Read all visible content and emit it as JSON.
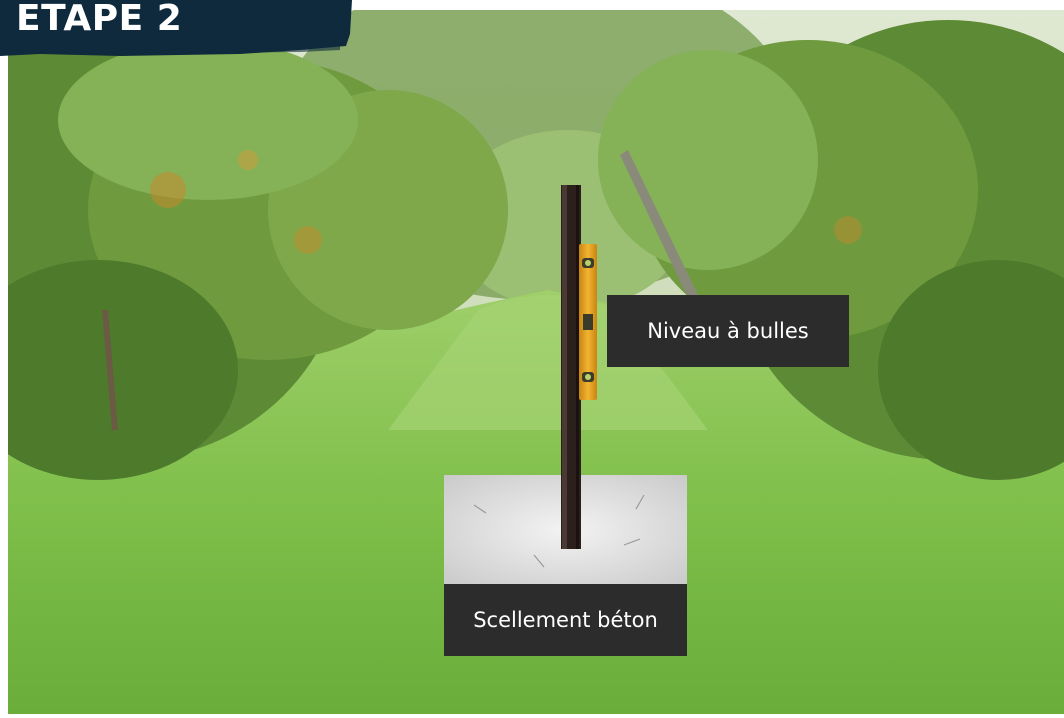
{
  "step": {
    "title": "ETAPE 2"
  },
  "labels": {
    "bubble_level": "Niveau à bulles",
    "concrete_seal": "Scellement béton"
  },
  "colors": {
    "banner": "#0f2a3d",
    "label_background": "#2c2c2c",
    "label_text": "#ffffff",
    "level": "#e8a21c",
    "post": "#2b201c"
  }
}
